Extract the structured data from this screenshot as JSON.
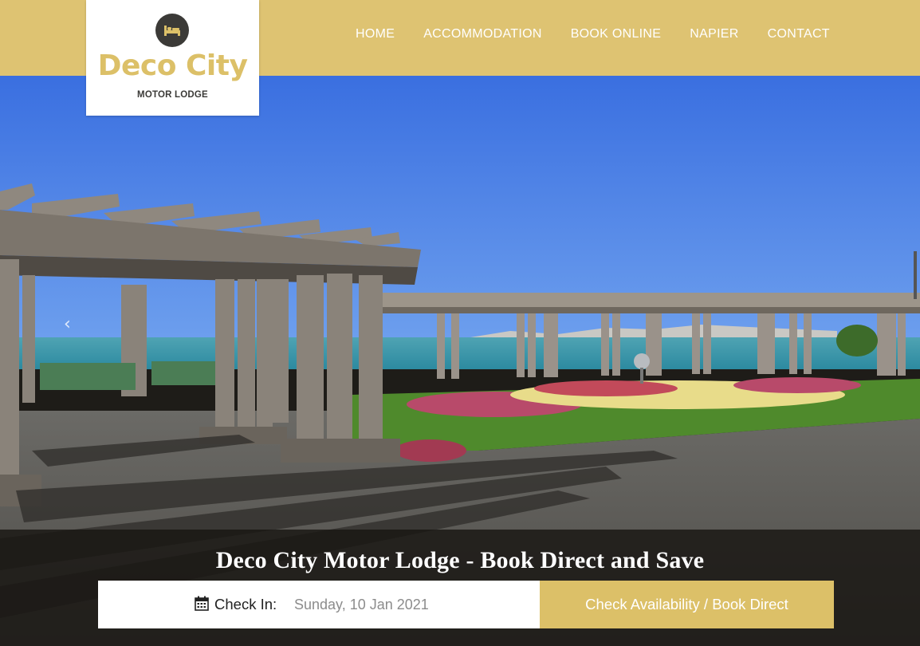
{
  "brand": {
    "name": "Deco City",
    "tagline": "MOTOR LODGE",
    "accent_color": "#dec372",
    "logo_icon": "bed-icon"
  },
  "nav": {
    "items": [
      {
        "label": "HOME"
      },
      {
        "label": "ACCOMMODATION"
      },
      {
        "label": "BOOK ONLINE"
      },
      {
        "label": "NAPIER"
      },
      {
        "label": "CONTACT"
      }
    ]
  },
  "hero": {
    "prev_icon": "chevron-left-icon"
  },
  "booking": {
    "title": "Deco City Motor Lodge - Book Direct and Save",
    "checkin_label": "Check In:",
    "checkin_value": "Sunday, 10 Jan 2021",
    "checkin_icon": "calendar-icon",
    "button_label": "Check Availability / Book Direct"
  }
}
